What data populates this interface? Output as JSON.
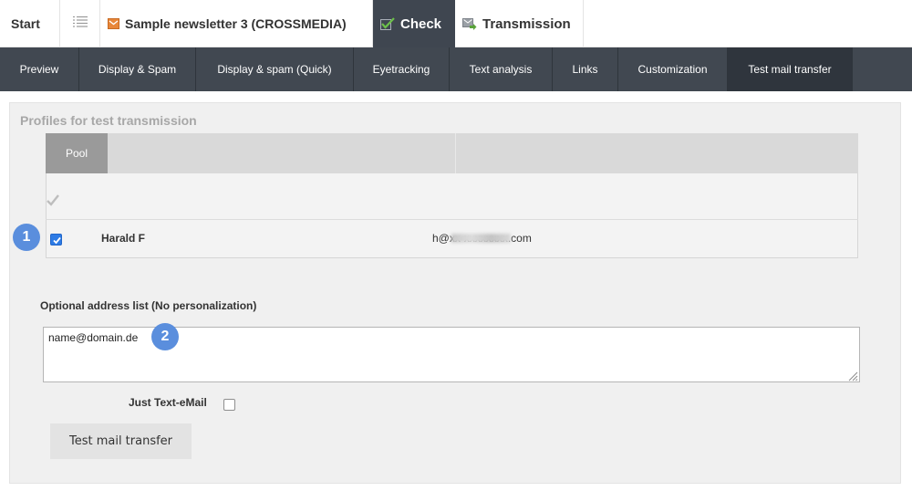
{
  "top_nav": {
    "start": "Start",
    "newsletter": "Sample newsletter 3 (CROSSMEDIA)",
    "check": "Check",
    "transmission": "Transmission"
  },
  "sub_nav": [
    {
      "label": "Preview"
    },
    {
      "label": "Display & Spam"
    },
    {
      "label": "Display & spam (Quick)"
    },
    {
      "label": "Eyetracking"
    },
    {
      "label": "Text analysis"
    },
    {
      "label": "Links"
    },
    {
      "label": "Customization"
    },
    {
      "label": "Test mail transfer",
      "active": true
    }
  ],
  "panel": {
    "title": "Profiles for test transmission",
    "pool_tab": "Pool",
    "profiles": [
      {
        "name": "Harald F",
        "email": "h@xx-xxxxxxxx.com",
        "checked": true
      }
    ],
    "address_label": "Optional address list (No personalization)",
    "address_value": "name@domain.de",
    "just_text_label": "Just Text-eMail",
    "just_text_checked": false,
    "send_button": "Test mail transfer"
  },
  "annotations": [
    "1",
    "2"
  ],
  "colors": {
    "topnav_active": "#3f4650",
    "subnav_bg": "#414851",
    "subnav_active": "#2f353d",
    "badge": "#5a8edd",
    "checkbox": "#2d7be5"
  },
  "icons": {
    "list": "list-icon",
    "newsletter": "envelope-icon",
    "check": "check-icon",
    "transmission": "send-mail-icon"
  }
}
